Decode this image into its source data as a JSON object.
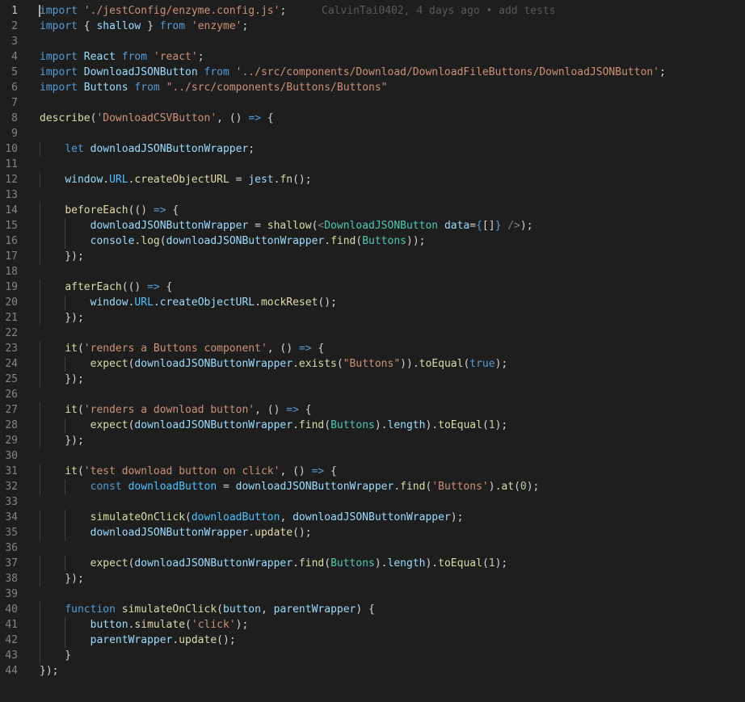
{
  "editor": {
    "current_line": 1,
    "blame": {
      "line": 1,
      "text": "CalvinTai0402, 4 days ago • add tests"
    },
    "lines": [
      [
        [
          "kw",
          "import"
        ],
        [
          "pl",
          " "
        ],
        [
          "str",
          "'./jestConfig/enzyme.config.js'"
        ],
        [
          "pl",
          ";"
        ]
      ],
      [
        [
          "kw",
          "import"
        ],
        [
          "pl",
          " { "
        ],
        [
          "var",
          "shallow"
        ],
        [
          "pl",
          " } "
        ],
        [
          "kw",
          "from"
        ],
        [
          "pl",
          " "
        ],
        [
          "str",
          "'enzyme'"
        ],
        [
          "pl",
          ";"
        ]
      ],
      [],
      [
        [
          "kw",
          "import"
        ],
        [
          "pl",
          " "
        ],
        [
          "var",
          "React"
        ],
        [
          "pl",
          " "
        ],
        [
          "kw",
          "from"
        ],
        [
          "pl",
          " "
        ],
        [
          "str",
          "'react'"
        ],
        [
          "pl",
          ";"
        ]
      ],
      [
        [
          "kw",
          "import"
        ],
        [
          "pl",
          " "
        ],
        [
          "var",
          "DownloadJSONButton"
        ],
        [
          "pl",
          " "
        ],
        [
          "kw",
          "from"
        ],
        [
          "pl",
          " "
        ],
        [
          "str",
          "'../src/components/Download/DownloadFileButtons/DownloadJSONButton'"
        ],
        [
          "pl",
          ";"
        ]
      ],
      [
        [
          "kw",
          "import"
        ],
        [
          "pl",
          " "
        ],
        [
          "var",
          "Buttons"
        ],
        [
          "pl",
          " "
        ],
        [
          "kw",
          "from"
        ],
        [
          "pl",
          " "
        ],
        [
          "str",
          "\"../src/components/Buttons/Buttons\""
        ]
      ],
      [],
      [
        [
          "fn",
          "describe"
        ],
        [
          "pl",
          "("
        ],
        [
          "str",
          "'DownloadCSVButton'"
        ],
        [
          "pl",
          ", () "
        ],
        [
          "kw",
          "=>"
        ],
        [
          "pl",
          " {"
        ]
      ],
      [],
      [
        [
          "pl",
          "    "
        ],
        [
          "kw",
          "let"
        ],
        [
          "pl",
          " "
        ],
        [
          "var",
          "downloadJSONButtonWrapper"
        ],
        [
          "pl",
          ";"
        ]
      ],
      [],
      [
        [
          "pl",
          "    "
        ],
        [
          "var",
          "window"
        ],
        [
          "pl",
          "."
        ],
        [
          "cst",
          "URL"
        ],
        [
          "pl",
          "."
        ],
        [
          "fn",
          "createObjectURL"
        ],
        [
          "pl",
          " = "
        ],
        [
          "var",
          "jest"
        ],
        [
          "pl",
          "."
        ],
        [
          "fn",
          "fn"
        ],
        [
          "pl",
          "();"
        ]
      ],
      [],
      [
        [
          "pl",
          "    "
        ],
        [
          "fn",
          "beforeEach"
        ],
        [
          "pl",
          "(() "
        ],
        [
          "kw",
          "=>"
        ],
        [
          "pl",
          " {"
        ]
      ],
      [
        [
          "pl",
          "        "
        ],
        [
          "var",
          "downloadJSONButtonWrapper"
        ],
        [
          "pl",
          " = "
        ],
        [
          "fn",
          "shallow"
        ],
        [
          "pl",
          "("
        ],
        [
          "br",
          "<"
        ],
        [
          "tag",
          "DownloadJSONButton"
        ],
        [
          "pl",
          " "
        ],
        [
          "var",
          "data"
        ],
        [
          "pl",
          "="
        ],
        [
          "kw",
          "{"
        ],
        [
          "pl",
          "[]"
        ],
        [
          "kw",
          "}"
        ],
        [
          "pl",
          " "
        ],
        [
          "br",
          "/>"
        ],
        [
          "pl",
          ");"
        ]
      ],
      [
        [
          "pl",
          "        "
        ],
        [
          "var",
          "console"
        ],
        [
          "pl",
          "."
        ],
        [
          "fn",
          "log"
        ],
        [
          "pl",
          "("
        ],
        [
          "var",
          "downloadJSONButtonWrapper"
        ],
        [
          "pl",
          "."
        ],
        [
          "fn",
          "find"
        ],
        [
          "pl",
          "("
        ],
        [
          "cls",
          "Buttons"
        ],
        [
          "pl",
          "));"
        ]
      ],
      [
        [
          "pl",
          "    });"
        ]
      ],
      [],
      [
        [
          "pl",
          "    "
        ],
        [
          "fn",
          "afterEach"
        ],
        [
          "pl",
          "(() "
        ],
        [
          "kw",
          "=>"
        ],
        [
          "pl",
          " {"
        ]
      ],
      [
        [
          "pl",
          "        "
        ],
        [
          "var",
          "window"
        ],
        [
          "pl",
          "."
        ],
        [
          "cst",
          "URL"
        ],
        [
          "pl",
          "."
        ],
        [
          "var",
          "createObjectURL"
        ],
        [
          "pl",
          "."
        ],
        [
          "fn",
          "mockReset"
        ],
        [
          "pl",
          "();"
        ]
      ],
      [
        [
          "pl",
          "    });"
        ]
      ],
      [],
      [
        [
          "pl",
          "    "
        ],
        [
          "fn",
          "it"
        ],
        [
          "pl",
          "("
        ],
        [
          "str",
          "'renders a Buttons component'"
        ],
        [
          "pl",
          ", () "
        ],
        [
          "kw",
          "=>"
        ],
        [
          "pl",
          " {"
        ]
      ],
      [
        [
          "pl",
          "        "
        ],
        [
          "fn",
          "expect"
        ],
        [
          "pl",
          "("
        ],
        [
          "var",
          "downloadJSONButtonWrapper"
        ],
        [
          "pl",
          "."
        ],
        [
          "fn",
          "exists"
        ],
        [
          "pl",
          "("
        ],
        [
          "str",
          "\"Buttons\""
        ],
        [
          "pl",
          "))."
        ],
        [
          "fn",
          "toEqual"
        ],
        [
          "pl",
          "("
        ],
        [
          "kw",
          "true"
        ],
        [
          "pl",
          ");"
        ]
      ],
      [
        [
          "pl",
          "    });"
        ]
      ],
      [],
      [
        [
          "pl",
          "    "
        ],
        [
          "fn",
          "it"
        ],
        [
          "pl",
          "("
        ],
        [
          "str",
          "'renders a download button'"
        ],
        [
          "pl",
          ", () "
        ],
        [
          "kw",
          "=>"
        ],
        [
          "pl",
          " {"
        ]
      ],
      [
        [
          "pl",
          "        "
        ],
        [
          "fn",
          "expect"
        ],
        [
          "pl",
          "("
        ],
        [
          "var",
          "downloadJSONButtonWrapper"
        ],
        [
          "pl",
          "."
        ],
        [
          "fn",
          "find"
        ],
        [
          "pl",
          "("
        ],
        [
          "cls",
          "Buttons"
        ],
        [
          "pl",
          ")."
        ],
        [
          "var",
          "length"
        ],
        [
          "pl",
          ")."
        ],
        [
          "fn",
          "toEqual"
        ],
        [
          "pl",
          "("
        ],
        [
          "num",
          "1"
        ],
        [
          "pl",
          ");"
        ]
      ],
      [
        [
          "pl",
          "    });"
        ]
      ],
      [],
      [
        [
          "pl",
          "    "
        ],
        [
          "fn",
          "it"
        ],
        [
          "pl",
          "("
        ],
        [
          "str",
          "'test download button on click'"
        ],
        [
          "pl",
          ", () "
        ],
        [
          "kw",
          "=>"
        ],
        [
          "pl",
          " {"
        ]
      ],
      [
        [
          "pl",
          "        "
        ],
        [
          "kw",
          "const"
        ],
        [
          "pl",
          " "
        ],
        [
          "cst",
          "downloadButton"
        ],
        [
          "pl",
          " = "
        ],
        [
          "var",
          "downloadJSONButtonWrapper"
        ],
        [
          "pl",
          "."
        ],
        [
          "fn",
          "find"
        ],
        [
          "pl",
          "("
        ],
        [
          "str",
          "'Buttons'"
        ],
        [
          "pl",
          ")."
        ],
        [
          "fn",
          "at"
        ],
        [
          "pl",
          "("
        ],
        [
          "num",
          "0"
        ],
        [
          "pl",
          ");"
        ]
      ],
      [],
      [
        [
          "pl",
          "        "
        ],
        [
          "fn",
          "simulateOnClick"
        ],
        [
          "pl",
          "("
        ],
        [
          "cst",
          "downloadButton"
        ],
        [
          "pl",
          ", "
        ],
        [
          "var",
          "downloadJSONButtonWrapper"
        ],
        [
          "pl",
          ");"
        ]
      ],
      [
        [
          "pl",
          "        "
        ],
        [
          "var",
          "downloadJSONButtonWrapper"
        ],
        [
          "pl",
          "."
        ],
        [
          "fn",
          "update"
        ],
        [
          "pl",
          "();"
        ]
      ],
      [],
      [
        [
          "pl",
          "        "
        ],
        [
          "fn",
          "expect"
        ],
        [
          "pl",
          "("
        ],
        [
          "var",
          "downloadJSONButtonWrapper"
        ],
        [
          "pl",
          "."
        ],
        [
          "fn",
          "find"
        ],
        [
          "pl",
          "("
        ],
        [
          "cls",
          "Buttons"
        ],
        [
          "pl",
          ")."
        ],
        [
          "var",
          "length"
        ],
        [
          "pl",
          ")."
        ],
        [
          "fn",
          "toEqual"
        ],
        [
          "pl",
          "("
        ],
        [
          "num",
          "1"
        ],
        [
          "pl",
          ");"
        ]
      ],
      [
        [
          "pl",
          "    });"
        ]
      ],
      [],
      [
        [
          "pl",
          "    "
        ],
        [
          "kw",
          "function"
        ],
        [
          "pl",
          " "
        ],
        [
          "fn",
          "simulateOnClick"
        ],
        [
          "pl",
          "("
        ],
        [
          "var",
          "button"
        ],
        [
          "pl",
          ", "
        ],
        [
          "var",
          "parentWrapper"
        ],
        [
          "pl",
          ") {"
        ]
      ],
      [
        [
          "pl",
          "        "
        ],
        [
          "var",
          "button"
        ],
        [
          "pl",
          "."
        ],
        [
          "fn",
          "simulate"
        ],
        [
          "pl",
          "("
        ],
        [
          "str",
          "'click'"
        ],
        [
          "pl",
          ");"
        ]
      ],
      [
        [
          "pl",
          "        "
        ],
        [
          "var",
          "parentWrapper"
        ],
        [
          "pl",
          "."
        ],
        [
          "fn",
          "update"
        ],
        [
          "pl",
          "();"
        ]
      ],
      [
        [
          "pl",
          "    }"
        ]
      ],
      [
        [
          "pl",
          "});"
        ]
      ]
    ]
  }
}
